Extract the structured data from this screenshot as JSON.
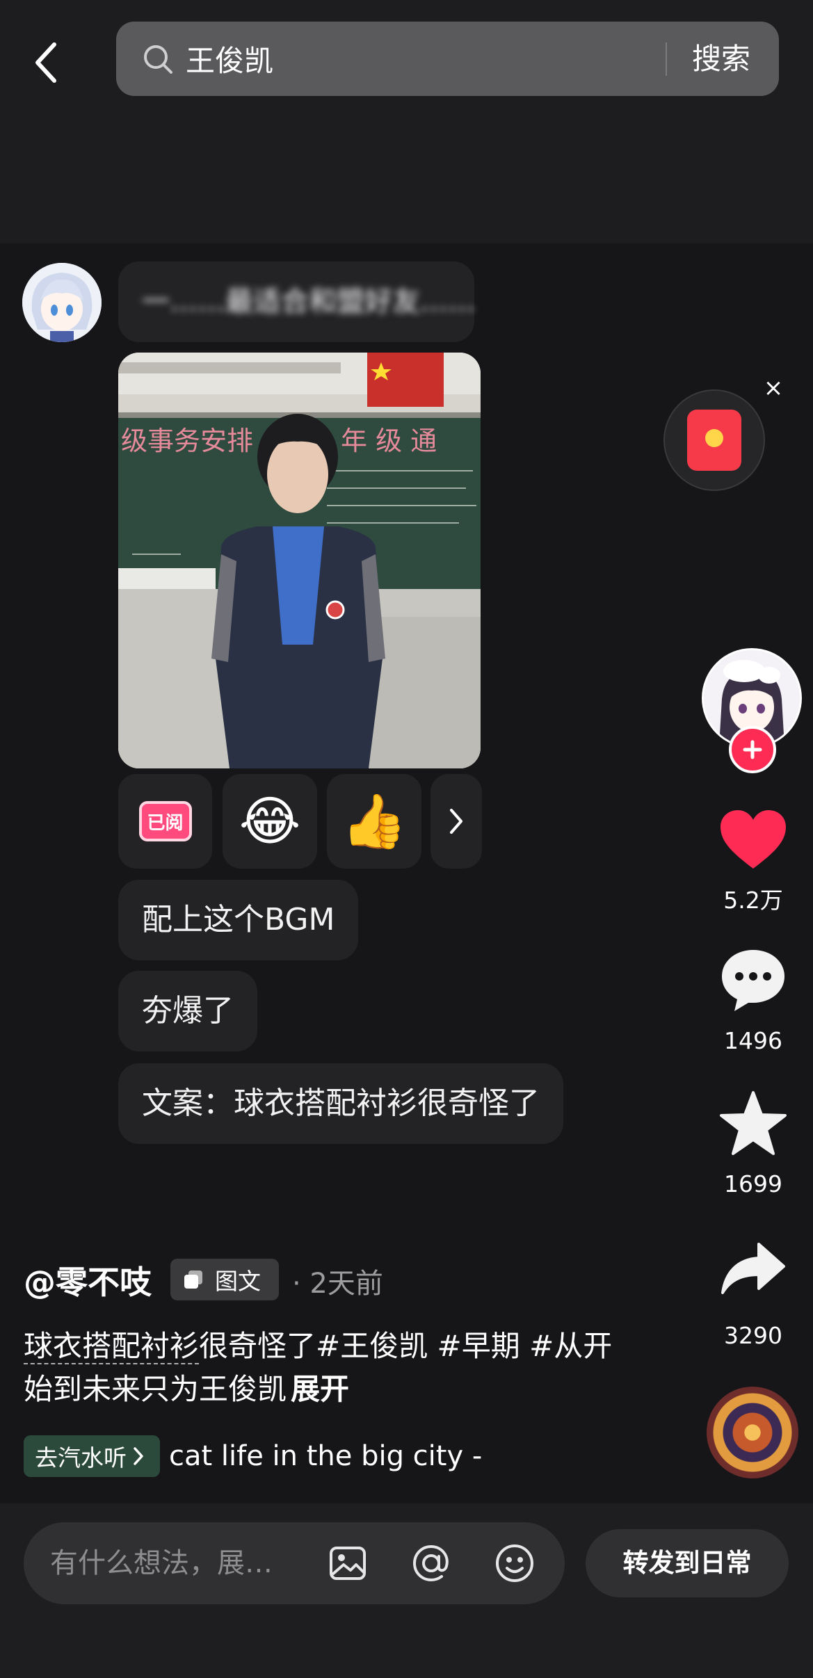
{
  "search": {
    "query": "王俊凯",
    "button_label": "搜索"
  },
  "post": {
    "blurred_line": "一……最适合和盟好友……",
    "reactions": {
      "read_badge": "已阅",
      "laugh_emoji": "😂",
      "thumb_emoji": "👍",
      "more_icon": "chevron-right-icon"
    },
    "messages": [
      "配上这个BGM",
      "夯爆了",
      "文案：球衣搭配衬衫很奇怪了"
    ]
  },
  "sidebar": {
    "like_count": "5.2万",
    "comment_count": "1496",
    "favorite_count": "1699",
    "share_count": "3290"
  },
  "caption": {
    "author": "@零不吱",
    "type_tag": "图文",
    "time": "· 2天前",
    "text_underlined": "球衣搭配衬衫",
    "text_rest": "很奇怪了#王俊凯 #早期 #从开始到未来只为王俊凯",
    "expand_label": "展开"
  },
  "music": {
    "tag_label": "去汽水听",
    "title": "cat life in the big city -"
  },
  "bottom": {
    "comment_placeholder": "有什么想法，展…",
    "repost_label": "转发到日常"
  },
  "colors": {
    "background": "#161619",
    "like_red": "#fe2c55",
    "bubble": "#232326",
    "read_badge": "#ff4a7e",
    "music_tag": "#2c4a3b"
  }
}
